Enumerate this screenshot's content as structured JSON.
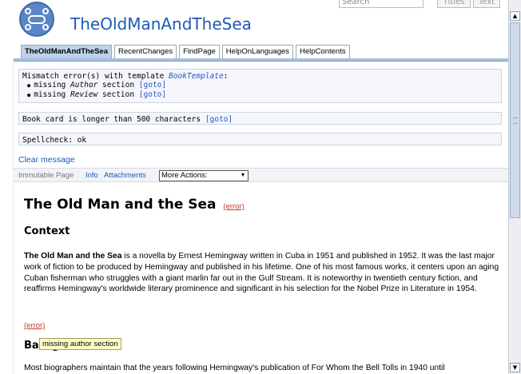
{
  "header": {
    "site_title": "TheOldManAndTheSea",
    "search_placeholder": "Search",
    "titles_button": "Titles",
    "text_button": "Text"
  },
  "tabs": [
    {
      "label": "TheOldManAndTheSea",
      "active": true
    },
    {
      "label": "RecentChanges",
      "active": false
    },
    {
      "label": "FindPage",
      "active": false
    },
    {
      "label": "HelpOnLanguages",
      "active": false
    },
    {
      "label": "HelpContents",
      "active": false
    }
  ],
  "messages": {
    "template_error": {
      "prefix": "Mismatch error(s) with template ",
      "template_link": "BookTemplate",
      "suffix": ":",
      "items": [
        {
          "pre": "missing ",
          "section": "Author",
          "post": " section ",
          "goto": "[goto]"
        },
        {
          "pre": "missing ",
          "section": "Review",
          "post": " section ",
          "goto": "[goto]"
        }
      ]
    },
    "card_length": {
      "text": "Book card is longer than 500 characters ",
      "goto": "[goto]"
    },
    "spellcheck": "Spellcheck: ok",
    "clear": "Clear message"
  },
  "action_bar": {
    "immutable": "Immutable Page",
    "info": "Info",
    "attachments": "Attachments",
    "more_actions": "More Actions:"
  },
  "content": {
    "title": "The Old Man and the Sea",
    "title_error": "(error)",
    "context_heading": "Context",
    "para1_bold": "The Old Man and the Sea",
    "para1_rest": " is a novella by Ernest Hemingway written in Cuba in 1951 and published in 1952. It was the last major work of fiction to be produced by Hemingway and published in his lifetime. One of his most famous works, it centers upon an aging Cuban fisherman who struggles with a giant marlin far out in the Gulf Stream. It is noteworthy in twentieth century fiction, and reaffirms Hemingway's worldwide literary prominence and significant in his selection for the Nobel Prize in Literature in 1954.",
    "error2": "(error)",
    "background_heading": "Background",
    "tooltip": "missing author section",
    "para2": "Most biographers maintain that the years following Hemingway's publication of For Whom the Bell Tolls in 1940 until"
  }
}
